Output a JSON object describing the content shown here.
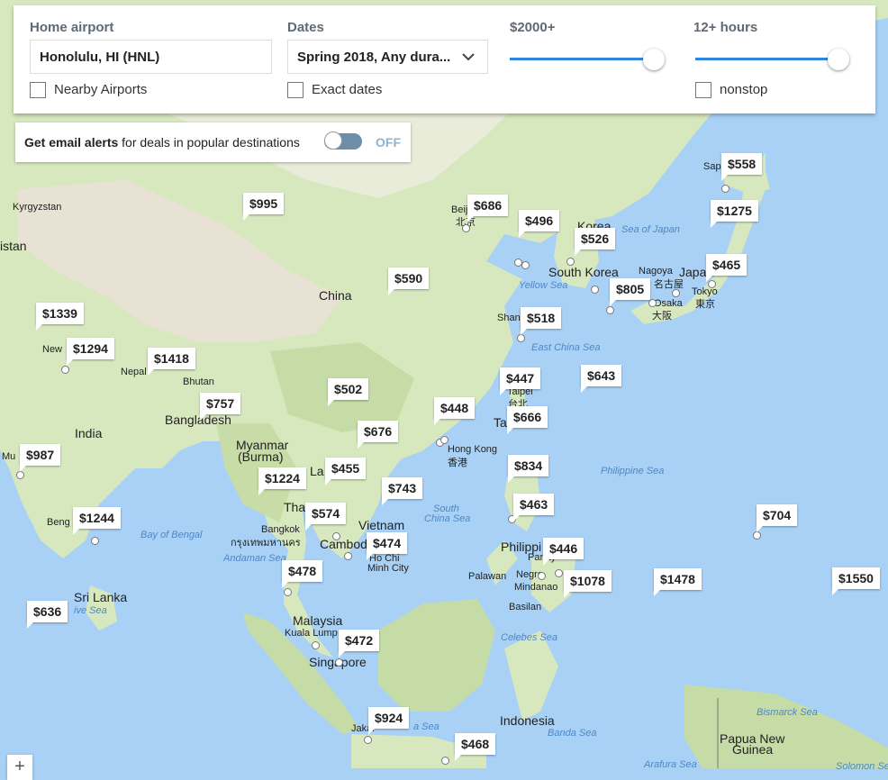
{
  "filters": {
    "home_airport_label": "Home airport",
    "home_airport_value": "Honolulu, HI (HNL)",
    "nearby_label": "Nearby Airports",
    "dates_label": "Dates",
    "dates_value": "Spring 2018, Any dura...",
    "exact_label": "Exact dates",
    "price_label": "$2000+",
    "duration_label": "12+ hours",
    "nonstop_label": "nonstop"
  },
  "alerts": {
    "bold_text": "Get email alerts",
    "rest_text": " for deals in popular destinations",
    "toggle_state": "OFF"
  },
  "map_labels": {
    "china": "China",
    "india": "India",
    "nepal": "Nepal",
    "bhutan": "Bhutan",
    "bangladesh": "Bangladesh",
    "myanmar": "Myanmar",
    "burma": "(Burma)",
    "thailand": "Tha",
    "vietnam": "Vietnam",
    "cambodia": "Cambod",
    "sri_lanka": "Sri Lanka",
    "malaysia": "Malaysia",
    "kuala": "Kuala Lump",
    "singapore": "Singapore",
    "indonesia": "Indonesia",
    "philippines": "Philippi",
    "south_korea": "South Korea",
    "korea": "Korea",
    "japan": "Japa",
    "kyrgyzstan": "Kyrgyzstan",
    "istan": "istan",
    "hong_kong": "Hong Kong",
    "hong_kong_zh": "香港",
    "taipei": "Taipei",
    "taipei_zh": "台北",
    "tai": "Ta",
    "nagoya": "Nagoya",
    "nagoya_zh": "名古屋",
    "osaka": "Osaka",
    "osaka_zh": "大阪",
    "tokyo": "Tokyo",
    "tokyo_zh": "東京",
    "sapp": "Sapp",
    "beij": "Beij",
    "beij_zh": "北京",
    "shang": "Shang",
    "bangkok": "Bangkok",
    "bangkok_th": "กรุงเทพมหานคร",
    "ho_chi": "Ho Chi",
    "minh": "Minh City",
    "new": "New",
    "beng": "Beng",
    "palawan": "Palawan",
    "panay": "Panay",
    "negros": "Negro",
    "mindanao": "Mindanao",
    "basilan": "Basilan",
    "papua": "Papua New",
    "guinea": "Guinea",
    "jakarta": "Jakar",
    "mu": "Mu",
    "la": "La",
    "sea_japan": "Sea of Japan",
    "yellow_sea": "Yellow Sea",
    "east_china_sea": "East China Sea",
    "philippine_sea": "Philippine Sea",
    "south_china_sea": "South",
    "south_china_sea2": "China Sea",
    "bay_bengal": "Bay of Bengal",
    "andaman": "Andaman Sea",
    "celebes": "Celebes Sea",
    "banda": "Banda Sea",
    "bismarck": "Bismarck Sea",
    "arafura": "Arafura Sea",
    "java_sea": "a Sea",
    "solomon": "Solomon Sea",
    "ive_sea": "ive Sea"
  },
  "prices": [
    "$558",
    "$686",
    "$496",
    "$526",
    "$1275",
    "$995",
    "$465",
    "$805",
    "$590",
    "$518",
    "$1339",
    "$1294",
    "$1418",
    "$447",
    "$643",
    "$502",
    "$757",
    "$448",
    "$666",
    "$676",
    "$987",
    "$455",
    "$834",
    "$743",
    "$1224",
    "$463",
    "$574",
    "$704",
    "$1244",
    "$474",
    "$446",
    "$478",
    "$1078",
    "$1478",
    "$1550",
    "$636",
    "$472",
    "$924",
    "$468"
  ],
  "colors": {
    "water": "#a8d1f5",
    "land": "#d7e8bf",
    "accent": "#2f86de"
  },
  "zoom_in": "+"
}
